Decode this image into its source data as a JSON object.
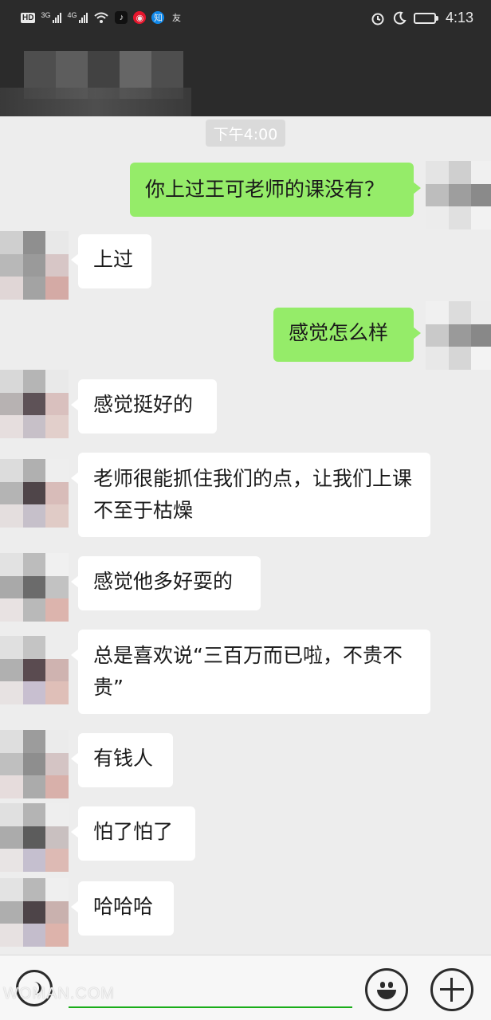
{
  "status_bar": {
    "hd_badge": "HD",
    "network_1": "3G",
    "network_2": "4G",
    "app_icons": [
      "tiktok-icon",
      "weibo-icon",
      "zhihu-icon",
      "friends-icon"
    ],
    "zhihu_label": "知",
    "friends_label": "友",
    "system_icons": [
      "alarm-icon",
      "moon-icon",
      "battery-icon"
    ],
    "battery_level": 0.5,
    "time": "4:13"
  },
  "chat": {
    "timestamp": "下午4:00",
    "messages": [
      {
        "side": "out",
        "text": "你上过王可老师的课没有？"
      },
      {
        "side": "in",
        "text": "上过"
      },
      {
        "side": "out",
        "text": "感觉怎么样"
      },
      {
        "side": "in",
        "text": "感觉挺好的"
      },
      {
        "side": "in",
        "text": "老师很能抓住我们的点，让我们上课不至于枯燥"
      },
      {
        "side": "in",
        "text": "感觉他多好耍的"
      },
      {
        "side": "in",
        "text": "总是喜欢说“三百万而已啦，不贵不贵”"
      },
      {
        "side": "in",
        "text": "有钱人"
      },
      {
        "side": "in",
        "text": "怕了怕了"
      },
      {
        "side": "in",
        "text": "哈哈哈"
      }
    ]
  },
  "input_bar": {
    "icons": [
      "voice-icon",
      "emoji-icon",
      "plus-icon"
    ],
    "accent_color": "#1aad19"
  },
  "watermark": "WOMAN.COM",
  "colors": {
    "incoming_bubble": "#ffffff",
    "outgoing_bubble": "#95ec69",
    "chat_background": "#ededed",
    "header_background": "#2b2b2b"
  }
}
